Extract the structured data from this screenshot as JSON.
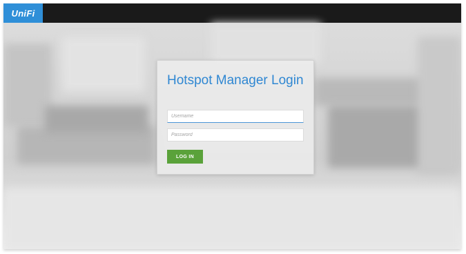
{
  "header": {
    "logo_text": "UniFi",
    "logo_color": "#2f8fd8",
    "bar_color": "#1a1a1a"
  },
  "login": {
    "title": "Hotspot Manager Login",
    "username": {
      "value": "",
      "placeholder": "Username"
    },
    "password": {
      "value": "",
      "placeholder": "Password"
    },
    "submit_label": "LOG IN",
    "submit_color": "#5aa23a",
    "title_color": "#2f87d2"
  }
}
